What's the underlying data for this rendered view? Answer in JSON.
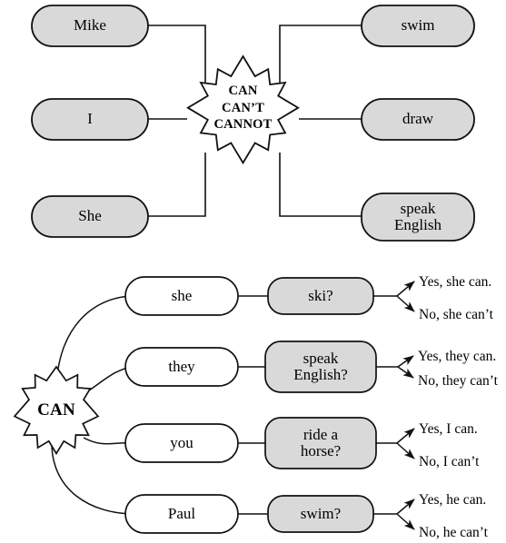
{
  "page": {
    "title": "CAN / CAN'T grammar diagrams worksheet",
    "background_color": "#ffffff",
    "ink_color": "#000000",
    "shaded_fill": "#d9d9d9",
    "plain_fill": "#ffffff"
  },
  "diagram_top": {
    "name": "can-cannot-sentence-builder",
    "center": {
      "shape": "starburst",
      "lines": [
        "CAN",
        "CAN’T",
        "CANNOT"
      ]
    },
    "subjects": [
      {
        "label": "Mike",
        "fill": "#d9d9d9"
      },
      {
        "label": "I",
        "fill": "#d9d9d9"
      },
      {
        "label": "She",
        "fill": "#d9d9d9"
      }
    ],
    "verbs": [
      {
        "label": "swim",
        "fill": "#d9d9d9"
      },
      {
        "label": "draw",
        "fill": "#d9d9d9"
      },
      {
        "label": "speak\nEnglish",
        "fill": "#d9d9d9"
      }
    ]
  },
  "diagram_bottom": {
    "name": "can-question-answer-builder",
    "center": {
      "shape": "starburst",
      "label": "CAN"
    },
    "rows": [
      {
        "subject": "she",
        "subject_fill": "#ffffff",
        "action": "ski?",
        "action_fill": "#d9d9d9",
        "answer_yes": "Yes, she can.",
        "answer_no": "No, she can’t"
      },
      {
        "subject": "they",
        "subject_fill": "#ffffff",
        "action": "speak\nEnglish?",
        "action_fill": "#d9d9d9",
        "answer_yes": "Yes, they can.",
        "answer_no": "No, they can’t"
      },
      {
        "subject": "you",
        "subject_fill": "#ffffff",
        "action": "ride a\nhorse?",
        "action_fill": "#d9d9d9",
        "answer_yes": "Yes, I can.",
        "answer_no": "No, I can’t"
      },
      {
        "subject": "Paul",
        "subject_fill": "#ffffff",
        "action": "swim?",
        "action_fill": "#d9d9d9",
        "answer_yes": "Yes, he can.",
        "answer_no": "No, he can’t"
      }
    ]
  }
}
